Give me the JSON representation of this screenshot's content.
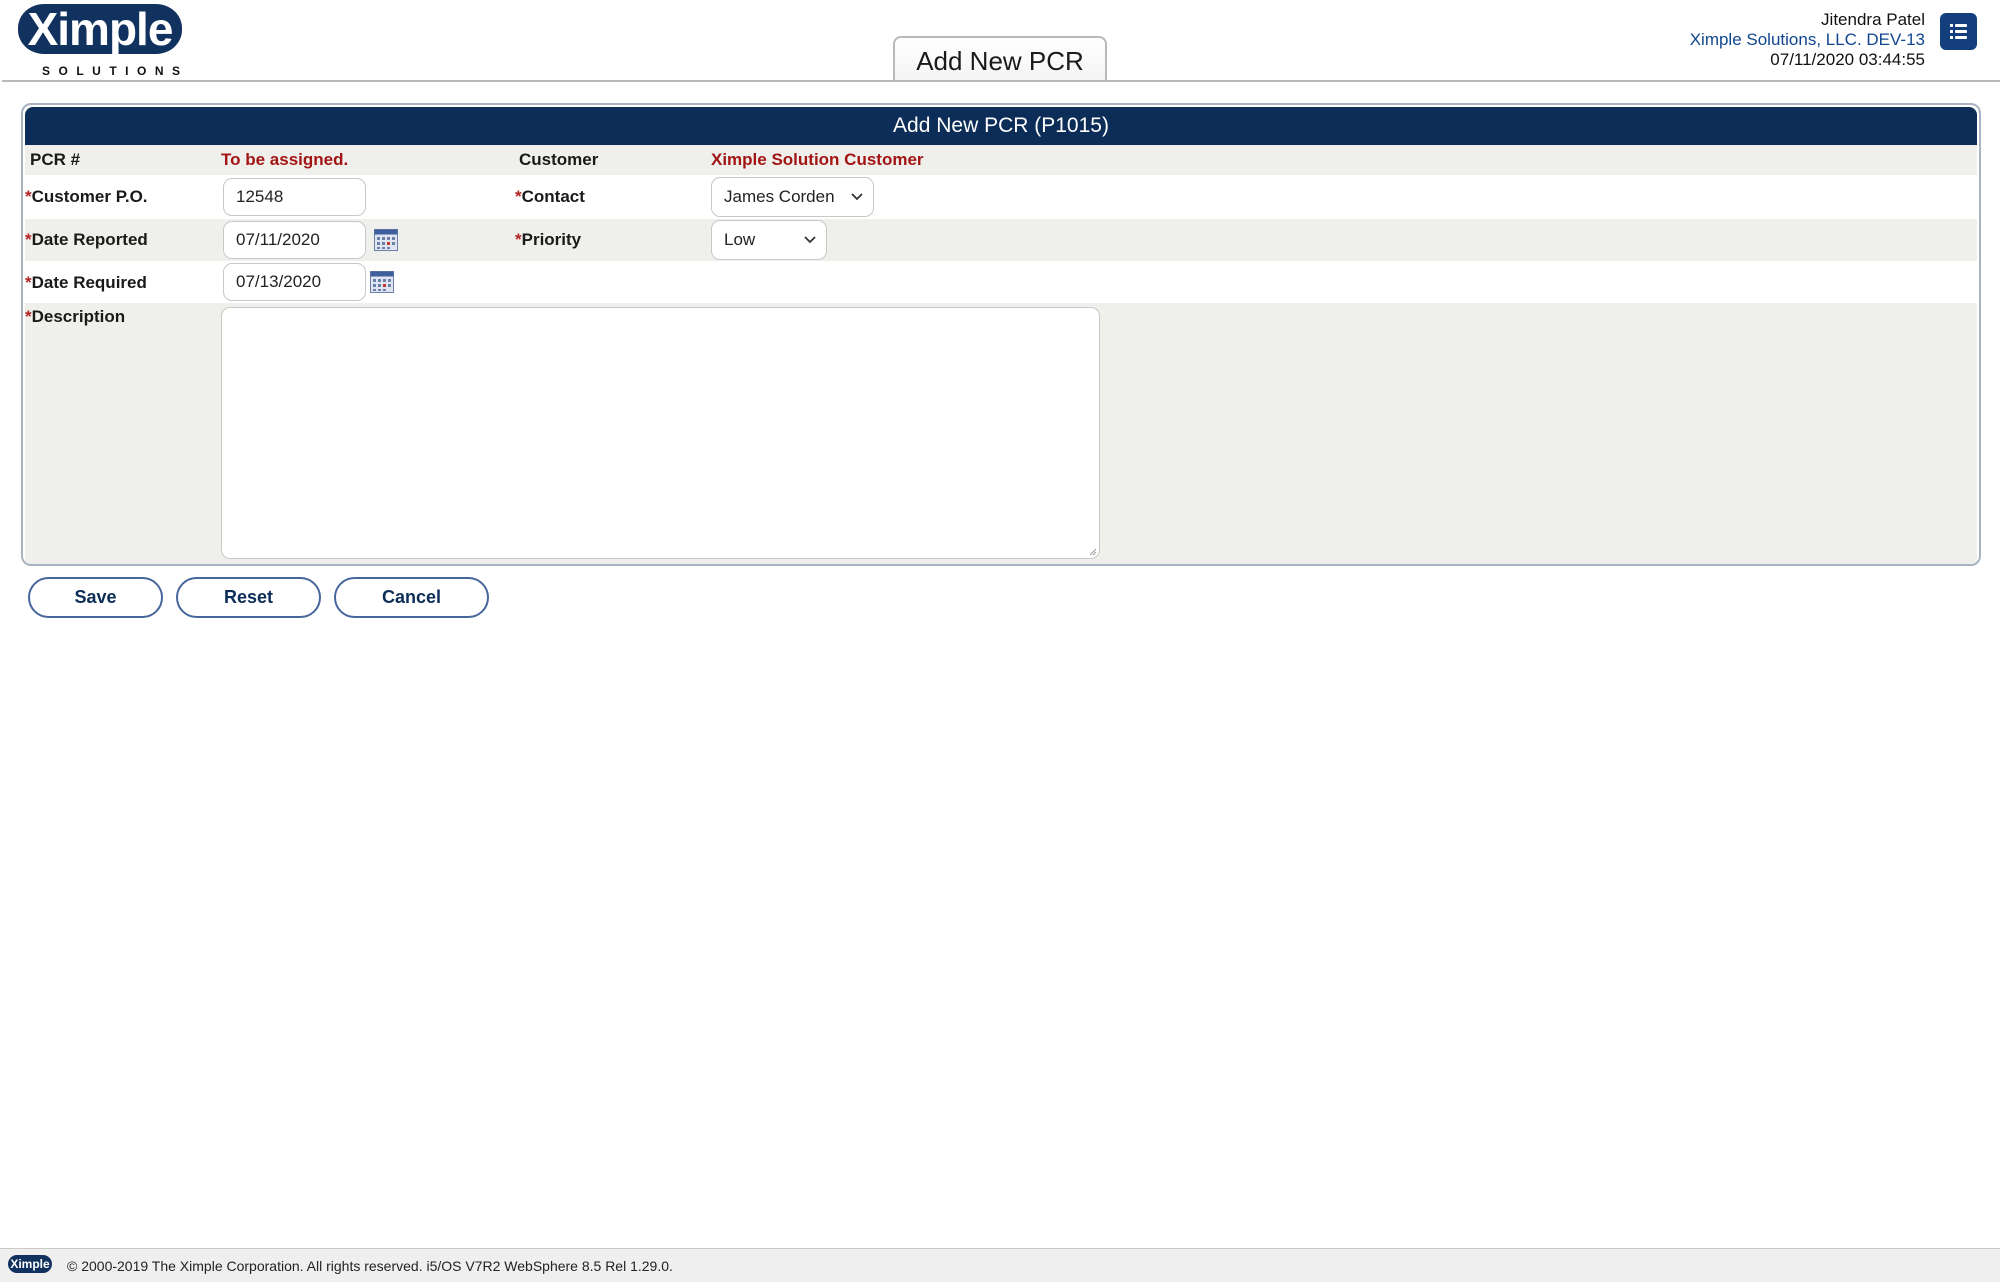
{
  "header": {
    "logo_text": "Ximple",
    "logo_sub": "SOLUTIONS",
    "page_tab": "Add New PCR",
    "user_name": "Jitendra Patel",
    "company": "Ximple Solutions, LLC. DEV-13",
    "datetime": "07/11/2020 03:44:55",
    "menu_icon": "list-icon"
  },
  "form": {
    "title": "Add New PCR (P1015)",
    "required_mark": "*",
    "pcr_label": "PCR #",
    "pcr_value": "To be assigned.",
    "customer_label": "Customer",
    "customer_value": "Ximple Solution Customer",
    "customer_po_label": "Customer P.O.",
    "customer_po_value": "12548",
    "contact_label": "Contact",
    "contact_value": "James Corden",
    "date_reported_label": "Date Reported",
    "date_reported_value": "07/11/2020",
    "priority_label": "Priority",
    "priority_value": "Low",
    "date_required_label": "Date Required",
    "date_required_value": "07/13/2020",
    "description_label": "Description",
    "description_value": ""
  },
  "buttons": {
    "save": "Save",
    "reset": "Reset",
    "cancel": "Cancel"
  },
  "footer": {
    "logo_text": "Ximple",
    "text": "© 2000-2019 The Ximple Corporation. All rights reserved. i5/OS V7R2 WebSphere 8.5 Rel 1.29.0."
  },
  "colors": {
    "navy": "#0c2d57",
    "required": "#b22222",
    "value_red": "#a31515",
    "row_alt": "#efefeb"
  }
}
